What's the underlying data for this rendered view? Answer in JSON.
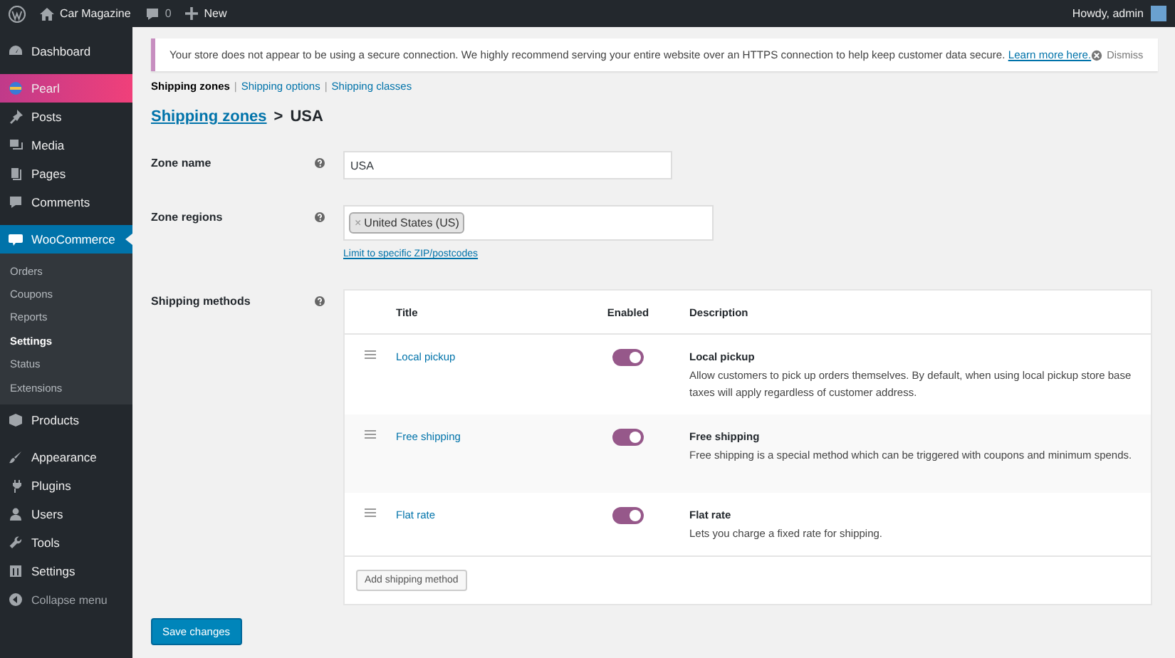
{
  "admin_bar": {
    "site_name": "Car Magazine",
    "comments_count": "0",
    "new_label": "New",
    "greeting": "Howdy, admin"
  },
  "sidebar": {
    "items": [
      {
        "label": "Dashboard",
        "selected": false,
        "highlighted": false
      },
      {
        "label": "Pearl",
        "selected": false,
        "highlighted": true
      },
      {
        "label": "Posts",
        "selected": false,
        "highlighted": false
      },
      {
        "label": "Media",
        "selected": false,
        "highlighted": false
      },
      {
        "label": "Pages",
        "selected": false,
        "highlighted": false
      },
      {
        "label": "Comments",
        "selected": false,
        "highlighted": false
      },
      {
        "label": "WooCommerce",
        "selected": true,
        "highlighted": false,
        "children": [
          {
            "label": "Orders",
            "selected": false
          },
          {
            "label": "Coupons",
            "selected": false
          },
          {
            "label": "Reports",
            "selected": false
          },
          {
            "label": "Settings",
            "selected": true
          },
          {
            "label": "Status",
            "selected": false
          },
          {
            "label": "Extensions",
            "selected": false
          }
        ]
      },
      {
        "label": "Products",
        "selected": false,
        "highlighted": false
      },
      {
        "label": "Appearance",
        "selected": false,
        "highlighted": false
      },
      {
        "label": "Plugins",
        "selected": false,
        "highlighted": false
      },
      {
        "label": "Users",
        "selected": false,
        "highlighted": false
      },
      {
        "label": "Tools",
        "selected": false,
        "highlighted": false
      },
      {
        "label": "Settings",
        "selected": false,
        "highlighted": false
      }
    ],
    "collapse_label": "Collapse menu"
  },
  "notice": {
    "text": "Your store does not appear to be using a secure connection. We highly recommend serving your entire website over an HTTPS connection to help keep customer data secure.",
    "link": "Learn more here.",
    "dismiss": "Dismiss"
  },
  "subnav": {
    "separator": "|",
    "tabs": [
      {
        "label": "Shipping zones",
        "selected": true
      },
      {
        "label": "Shipping options",
        "selected": false
      },
      {
        "label": "Shipping classes",
        "selected": false
      }
    ]
  },
  "heading": {
    "link": "Shipping zones",
    "separator": ">",
    "current": "USA"
  },
  "zone_name": {
    "label": "Zone name",
    "value": "USA"
  },
  "zone_regions": {
    "label": "Zone regions",
    "tags": [
      {
        "remove": "×",
        "label": "United States (US)"
      }
    ],
    "link": "Limit to specific ZIP/postcodes"
  },
  "shipping_methods": {
    "label": "Shipping methods",
    "columns": [
      "Title",
      "Enabled",
      "Description"
    ],
    "rows": [
      {
        "title": "Local pickup",
        "enabled": true,
        "description_title": "Local pickup",
        "description": "Allow customers to pick up orders themselves. By default, when using local pickup store base taxes will apply regardless of customer address."
      },
      {
        "title": "Free shipping",
        "enabled": true,
        "description_title": "Free shipping",
        "description": "Free shipping is a special method which can be triggered with coupons and minimum spends."
      },
      {
        "title": "Flat rate",
        "enabled": true,
        "description_title": "Flat rate",
        "description": "Lets you charge a fixed rate for shipping."
      }
    ],
    "add_button": "Add shipping method"
  },
  "save_button": "Save changes"
}
